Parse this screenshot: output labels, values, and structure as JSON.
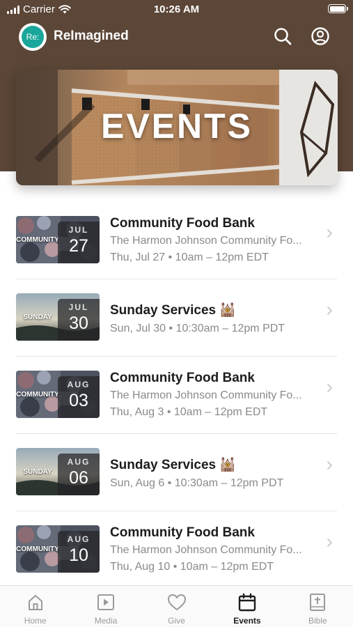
{
  "status_bar": {
    "carrier": "Carrier",
    "time": "10:26 AM"
  },
  "header": {
    "logo_text": "Re:",
    "app_name": "ReImagined",
    "icons": [
      "search-icon",
      "profile-icon"
    ]
  },
  "hero": {
    "title": "EVENTS"
  },
  "events": [
    {
      "title": "Community Food Bank",
      "subtitle": "The Harmon Johnson Community Fo...",
      "when": "Thu, Jul 27 • 10am – 12pm EDT",
      "month": "JUL",
      "day": "27",
      "thumb_label": "COMMUNITY",
      "thumb": "food"
    },
    {
      "title": "Sunday Services 🕍",
      "subtitle": "",
      "when": "Sun, Jul 30 • 10:30am – 12pm PDT",
      "month": "JUL",
      "day": "30",
      "thumb_label": "SUNDAY",
      "thumb": "sunday"
    },
    {
      "title": "Community Food Bank",
      "subtitle": "The Harmon Johnson Community Fo...",
      "when": "Thu, Aug 3 • 10am – 12pm EDT",
      "month": "AUG",
      "day": "03",
      "thumb_label": "COMMUNITY",
      "thumb": "food"
    },
    {
      "title": "Sunday Services 🕍",
      "subtitle": "",
      "when": "Sun, Aug 6 • 10:30am – 12pm PDT",
      "month": "AUG",
      "day": "06",
      "thumb_label": "SUNDAY",
      "thumb": "sunday"
    },
    {
      "title": "Community Food Bank",
      "subtitle": "The Harmon Johnson Community Fo...",
      "when": "Thu, Aug 10 • 10am – 12pm EDT",
      "month": "AUG",
      "day": "10",
      "thumb_label": "COMMUNITY",
      "thumb": "food"
    }
  ],
  "tabs": [
    {
      "label": "Home",
      "icon": "home-icon",
      "active": false
    },
    {
      "label": "Media",
      "icon": "play-icon",
      "active": false
    },
    {
      "label": "Give",
      "icon": "heart-icon",
      "active": false
    },
    {
      "label": "Events",
      "icon": "calendar-icon",
      "active": true
    },
    {
      "label": "Bible",
      "icon": "bible-icon",
      "active": false
    }
  ],
  "colors": {
    "header_bg": "#5b4637",
    "logo_accent": "#1aa69a",
    "active_tab": "#1c1c1e",
    "inactive_tab": "#9a9a9e"
  }
}
